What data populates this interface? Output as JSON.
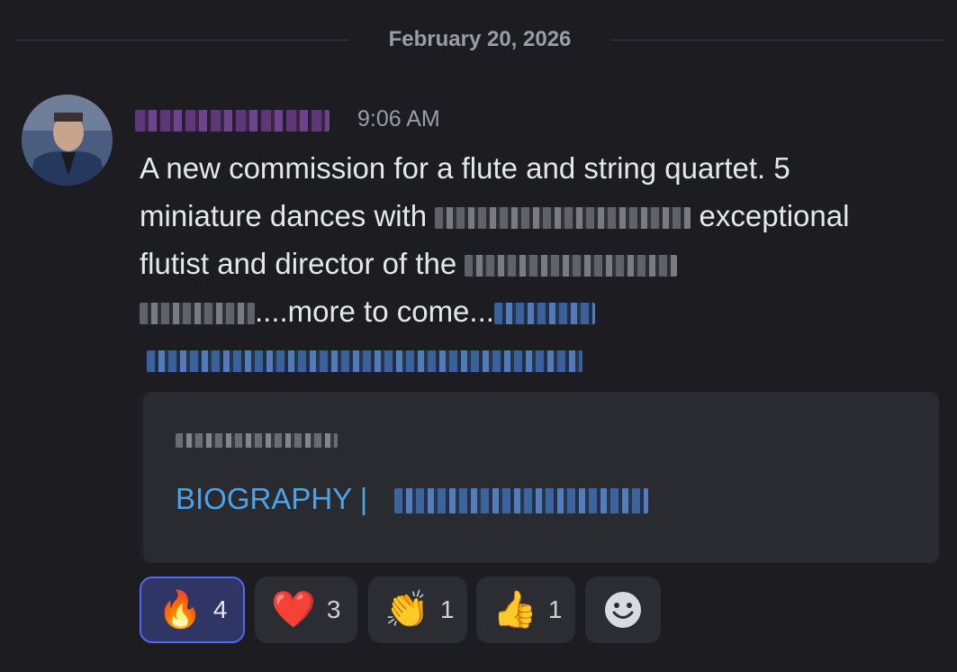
{
  "date_divider": {
    "label": "February 20, 2026"
  },
  "message": {
    "timestamp": "9:06 AM",
    "body": {
      "line1": "A new commission for a flute and string quartet. 5",
      "line2_start": "miniature dances with",
      "line2_end": "exceptional",
      "line3_start": "flutist and director of the",
      "line4_mid": "....more to come..."
    }
  },
  "embed": {
    "title": "BIOGRAPHY |"
  },
  "reactions": [
    {
      "emoji": "🔥",
      "count": "4",
      "active": true,
      "icon": "fire-emoji"
    },
    {
      "emoji": "❤️",
      "count": "3",
      "active": false,
      "icon": "heart-emoji"
    },
    {
      "emoji": "👏",
      "count": "1",
      "active": false,
      "icon": "clapping-hands-emoji"
    },
    {
      "emoji": "👍",
      "count": "1",
      "active": false,
      "icon": "thumbs-up-emoji"
    }
  ],
  "colors": {
    "background": "#1c1c21",
    "embed_background": "#2a2a31",
    "link": "#4da3e8",
    "active_reaction_border": "#5865f2",
    "username": "#7d4aa0"
  }
}
